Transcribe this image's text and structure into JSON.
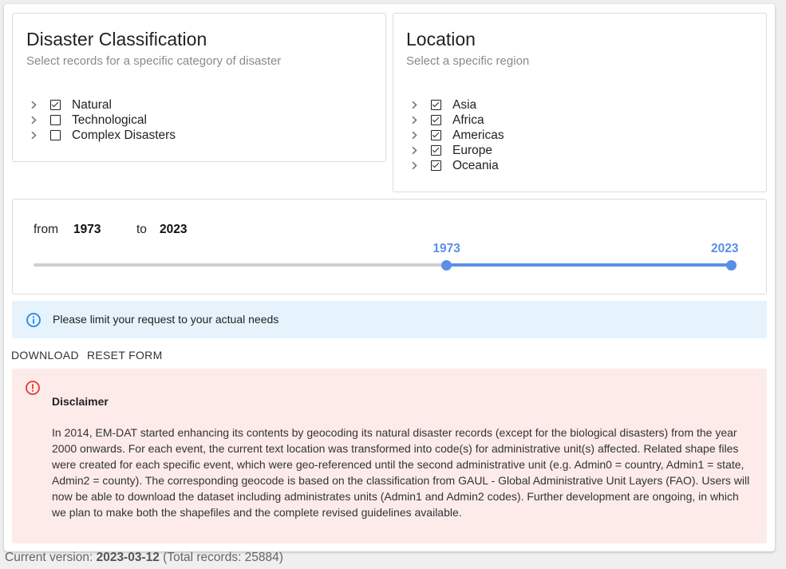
{
  "classification": {
    "title": "Disaster Classification",
    "subtitle": "Select records for a specific category of disaster",
    "items": [
      {
        "label": "Natural",
        "checked": true
      },
      {
        "label": "Technological",
        "checked": false
      },
      {
        "label": "Complex Disasters",
        "checked": false
      }
    ]
  },
  "location": {
    "title": "Location",
    "subtitle": "Select a specific region",
    "items": [
      {
        "label": "Asia",
        "checked": true
      },
      {
        "label": "Africa",
        "checked": true
      },
      {
        "label": "Americas",
        "checked": true
      },
      {
        "label": "Europe",
        "checked": true
      },
      {
        "label": "Oceania",
        "checked": true
      }
    ]
  },
  "year_range": {
    "from_label": "from",
    "to_label": "to",
    "from_value": "1973",
    "to_value": "2023",
    "slider_min_label": "1973",
    "slider_max_label": "2023",
    "start_fraction": 0.592,
    "end_fraction": 1.0
  },
  "info": {
    "message": "Please limit your request to your actual needs",
    "color": "#1e88e5"
  },
  "actions": {
    "download_label": "DOWNLOAD",
    "reset_label": "RESET FORM"
  },
  "disclaimer": {
    "title": "Disclaimer",
    "text": "In 2014, EM-DAT started enhancing its contents by geocoding its natural disaster records (except for the biological disasters) from the year 2000 onwards. For each event, the current text location was transformed into code(s) for administrative unit(s) affected. Related shape files were created for each specific event, which were geo-referenced until the second administrative unit (e.g. Admin0 = country, Admin1 = state, Admin2 = county). The corresponding geocode is based on the classification from GAUL - Global Administrative Unit Layers (FAO). Users will now be able to download the dataset including administrates units (Admin1 and Admin2 codes). Further development are ongoing, in which we plan to make both the shapefiles and the complete revised guidelines available.",
    "icon_color": "#e53935"
  },
  "footer": {
    "prefix": "Current version: ",
    "version": "2023-03-12",
    "records": " (Total records: 25884)"
  }
}
